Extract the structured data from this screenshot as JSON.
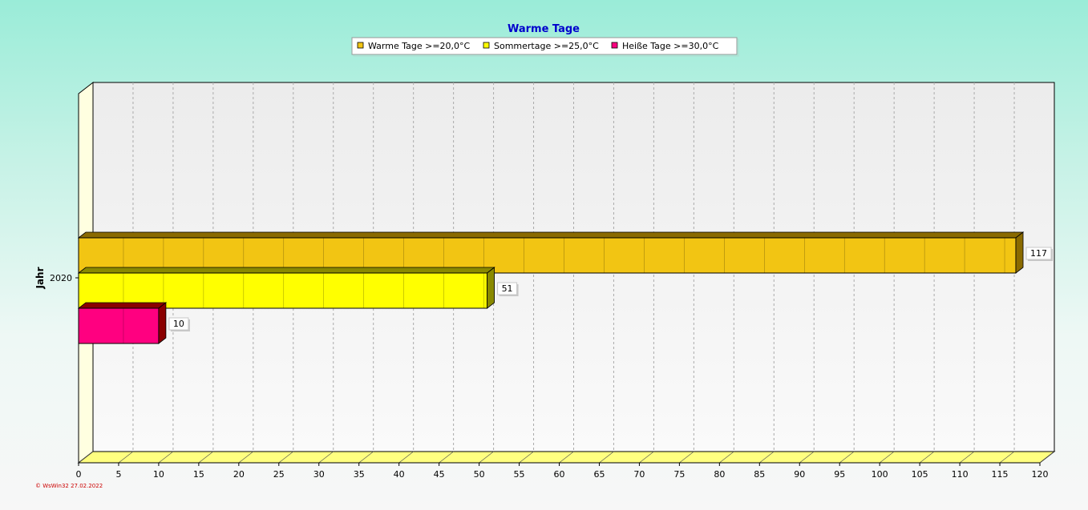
{
  "chart_data": {
    "type": "bar",
    "orientation": "horizontal",
    "title": "Warme Tage",
    "ylabel": "Jahr",
    "xlabel": "",
    "categories": [
      "2020"
    ],
    "series": [
      {
        "name": "Warme Tage >=20,0°C",
        "values": [
          117
        ],
        "color": "#f2c513",
        "side_color": "#8a6a00"
      },
      {
        "name": "Sommertage >=25,0°C",
        "values": [
          51
        ],
        "color": "#ffff00",
        "side_color": "#8a8a00"
      },
      {
        "name": "Heiße Tage >=30,0°C",
        "values": [
          10
        ],
        "color": "#ff0080",
        "side_color": "#8a0000"
      }
    ],
    "xlim": [
      0,
      120
    ],
    "xticks": [
      "0",
      "5",
      "10",
      "15",
      "20",
      "25",
      "30",
      "35",
      "40",
      "45",
      "50",
      "55",
      "60",
      "65",
      "70",
      "75",
      "80",
      "85",
      "90",
      "95",
      "100",
      "105",
      "110",
      "115",
      "120"
    ],
    "grid": true,
    "legend_position": "top"
  },
  "footer": {
    "text": "© WsWin32  27.02.2022"
  }
}
